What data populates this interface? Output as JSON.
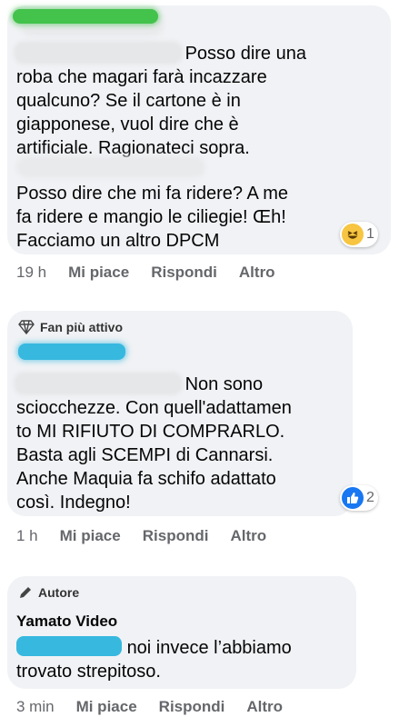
{
  "comments": [
    {
      "text_line1_suffix": "Posso dire una",
      "text_rest": "roba che magari farà incazzare\nqualcuno? Se il cartone è in\ngiapponese, vuol dire che è\nartificiale. Ragionateci sopra.",
      "text_second": "Posso dire che mi fa ridere? A me\nfa ridere e mangio le ciliegie! Œh!\nFacciamo un altro DPCM",
      "reaction": {
        "icon": "haha-emoji-icon",
        "count": "1"
      },
      "actions": {
        "time": "19 h",
        "like": "Mi piace",
        "reply": "Rispondi",
        "more": "Altro"
      }
    },
    {
      "badge": "Fan più attivo",
      "text_line1_suffix": "Non sono",
      "text_rest": "sciocchezze. Con quell'adattamen\nto MI RIFIUTO DI COMPRARLO.\nBasta agli SCEMPI di Cannarsi.\nAnche Maquia fa schifo adattato\ncosì. Indegno!",
      "reaction": {
        "icon": "like-thumb-icon",
        "count": "2"
      },
      "actions": {
        "time": "1 h",
        "like": "Mi piace",
        "reply": "Rispondi",
        "more": "Altro"
      }
    },
    {
      "badge": "Autore",
      "author": "Yamato Video",
      "text_line1_suffix": "noi invece l’abbiamo",
      "text_rest": "trovato strepitoso.",
      "actions": {
        "time": "3 min",
        "like": "Mi piace",
        "reply": "Rispondi",
        "more": "Altro"
      }
    }
  ],
  "colors": {
    "bubble": "#f0f2f5",
    "meta": "#65676b",
    "like_blue": "#1877f2",
    "haha_yellow": "#f7c542"
  }
}
